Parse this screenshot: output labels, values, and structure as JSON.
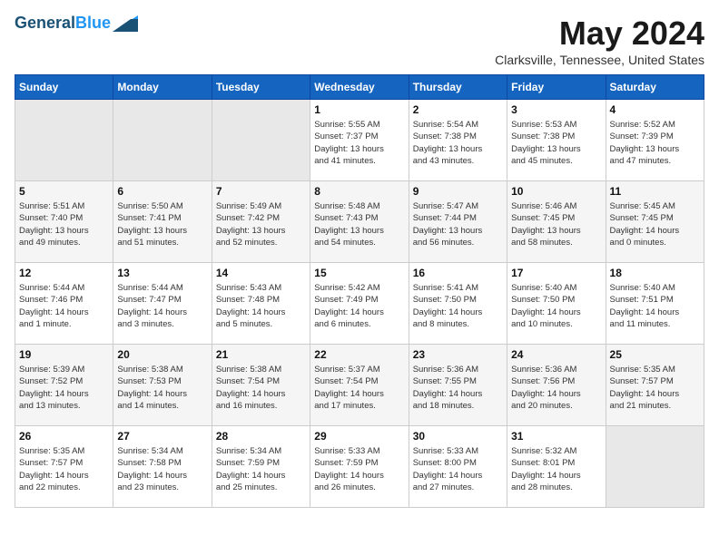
{
  "header": {
    "logo_line1": "General",
    "logo_line2": "Blue",
    "title": "May 2024",
    "subtitle": "Clarksville, Tennessee, United States"
  },
  "weekdays": [
    "Sunday",
    "Monday",
    "Tuesday",
    "Wednesday",
    "Thursday",
    "Friday",
    "Saturday"
  ],
  "weeks": [
    [
      {
        "day": "",
        "info": ""
      },
      {
        "day": "",
        "info": ""
      },
      {
        "day": "",
        "info": ""
      },
      {
        "day": "1",
        "info": "Sunrise: 5:55 AM\nSunset: 7:37 PM\nDaylight: 13 hours\nand 41 minutes."
      },
      {
        "day": "2",
        "info": "Sunrise: 5:54 AM\nSunset: 7:38 PM\nDaylight: 13 hours\nand 43 minutes."
      },
      {
        "day": "3",
        "info": "Sunrise: 5:53 AM\nSunset: 7:38 PM\nDaylight: 13 hours\nand 45 minutes."
      },
      {
        "day": "4",
        "info": "Sunrise: 5:52 AM\nSunset: 7:39 PM\nDaylight: 13 hours\nand 47 minutes."
      }
    ],
    [
      {
        "day": "5",
        "info": "Sunrise: 5:51 AM\nSunset: 7:40 PM\nDaylight: 13 hours\nand 49 minutes."
      },
      {
        "day": "6",
        "info": "Sunrise: 5:50 AM\nSunset: 7:41 PM\nDaylight: 13 hours\nand 51 minutes."
      },
      {
        "day": "7",
        "info": "Sunrise: 5:49 AM\nSunset: 7:42 PM\nDaylight: 13 hours\nand 52 minutes."
      },
      {
        "day": "8",
        "info": "Sunrise: 5:48 AM\nSunset: 7:43 PM\nDaylight: 13 hours\nand 54 minutes."
      },
      {
        "day": "9",
        "info": "Sunrise: 5:47 AM\nSunset: 7:44 PM\nDaylight: 13 hours\nand 56 minutes."
      },
      {
        "day": "10",
        "info": "Sunrise: 5:46 AM\nSunset: 7:45 PM\nDaylight: 13 hours\nand 58 minutes."
      },
      {
        "day": "11",
        "info": "Sunrise: 5:45 AM\nSunset: 7:45 PM\nDaylight: 14 hours\nand 0 minutes."
      }
    ],
    [
      {
        "day": "12",
        "info": "Sunrise: 5:44 AM\nSunset: 7:46 PM\nDaylight: 14 hours\nand 1 minute."
      },
      {
        "day": "13",
        "info": "Sunrise: 5:44 AM\nSunset: 7:47 PM\nDaylight: 14 hours\nand 3 minutes."
      },
      {
        "day": "14",
        "info": "Sunrise: 5:43 AM\nSunset: 7:48 PM\nDaylight: 14 hours\nand 5 minutes."
      },
      {
        "day": "15",
        "info": "Sunrise: 5:42 AM\nSunset: 7:49 PM\nDaylight: 14 hours\nand 6 minutes."
      },
      {
        "day": "16",
        "info": "Sunrise: 5:41 AM\nSunset: 7:50 PM\nDaylight: 14 hours\nand 8 minutes."
      },
      {
        "day": "17",
        "info": "Sunrise: 5:40 AM\nSunset: 7:50 PM\nDaylight: 14 hours\nand 10 minutes."
      },
      {
        "day": "18",
        "info": "Sunrise: 5:40 AM\nSunset: 7:51 PM\nDaylight: 14 hours\nand 11 minutes."
      }
    ],
    [
      {
        "day": "19",
        "info": "Sunrise: 5:39 AM\nSunset: 7:52 PM\nDaylight: 14 hours\nand 13 minutes."
      },
      {
        "day": "20",
        "info": "Sunrise: 5:38 AM\nSunset: 7:53 PM\nDaylight: 14 hours\nand 14 minutes."
      },
      {
        "day": "21",
        "info": "Sunrise: 5:38 AM\nSunset: 7:54 PM\nDaylight: 14 hours\nand 16 minutes."
      },
      {
        "day": "22",
        "info": "Sunrise: 5:37 AM\nSunset: 7:54 PM\nDaylight: 14 hours\nand 17 minutes."
      },
      {
        "day": "23",
        "info": "Sunrise: 5:36 AM\nSunset: 7:55 PM\nDaylight: 14 hours\nand 18 minutes."
      },
      {
        "day": "24",
        "info": "Sunrise: 5:36 AM\nSunset: 7:56 PM\nDaylight: 14 hours\nand 20 minutes."
      },
      {
        "day": "25",
        "info": "Sunrise: 5:35 AM\nSunset: 7:57 PM\nDaylight: 14 hours\nand 21 minutes."
      }
    ],
    [
      {
        "day": "26",
        "info": "Sunrise: 5:35 AM\nSunset: 7:57 PM\nDaylight: 14 hours\nand 22 minutes."
      },
      {
        "day": "27",
        "info": "Sunrise: 5:34 AM\nSunset: 7:58 PM\nDaylight: 14 hours\nand 23 minutes."
      },
      {
        "day": "28",
        "info": "Sunrise: 5:34 AM\nSunset: 7:59 PM\nDaylight: 14 hours\nand 25 minutes."
      },
      {
        "day": "29",
        "info": "Sunrise: 5:33 AM\nSunset: 7:59 PM\nDaylight: 14 hours\nand 26 minutes."
      },
      {
        "day": "30",
        "info": "Sunrise: 5:33 AM\nSunset: 8:00 PM\nDaylight: 14 hours\nand 27 minutes."
      },
      {
        "day": "31",
        "info": "Sunrise: 5:32 AM\nSunset: 8:01 PM\nDaylight: 14 hours\nand 28 minutes."
      },
      {
        "day": "",
        "info": ""
      }
    ]
  ]
}
